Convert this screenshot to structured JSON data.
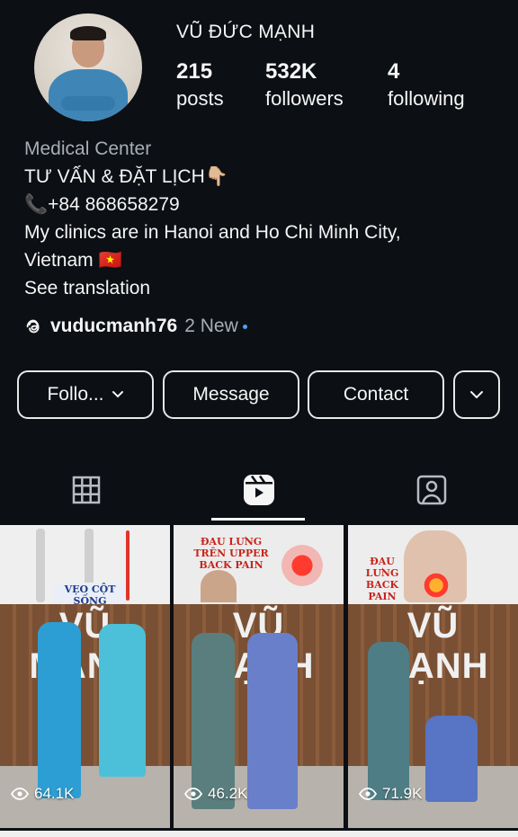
{
  "profile": {
    "name": "VŨ ĐỨC MẠNH",
    "stats": [
      {
        "value": "215",
        "label": "posts"
      },
      {
        "value": "532K",
        "label": "followers"
      },
      {
        "value": "4",
        "label": "following"
      }
    ],
    "category": "Medical Center",
    "bio_lines": [
      "TƯ VẤN & ĐẶT LỊCH👇🏼",
      "📞+84 868658279",
      "My clinics are in Hanoi and Ho Chi Minh City,",
      "Vietnam 🇻🇳"
    ],
    "see_translation": "See translation",
    "threads_handle": "vuducmanh76",
    "threads_new": "2 New"
  },
  "buttons": {
    "follow": "Follo...",
    "message": "Message",
    "contact": "Contact"
  },
  "tabs": [
    {
      "icon": "grid-icon",
      "active": false
    },
    {
      "icon": "reels-icon",
      "active": true
    },
    {
      "icon": "tagged-icon",
      "active": false
    }
  ],
  "reels": [
    {
      "views": "64.1K",
      "brand": "VŨ MẠNH",
      "caption": "VẸO CỘT SỐNG SCOLIOSIS"
    },
    {
      "views": "46.2K",
      "brand": "VŨ MẠNH",
      "caption": "ĐAU LƯNG TRÊN UPPER BACK PAIN"
    },
    {
      "views": "71.9K",
      "brand": "VŨ MẠNH",
      "caption": "ĐAU LƯNG BACK PAIN"
    }
  ],
  "colors": {
    "background": "#0c0f14",
    "text": "#f5f5f5",
    "muted": "#a8adb5",
    "threads_dot": "#4aa3ff"
  }
}
